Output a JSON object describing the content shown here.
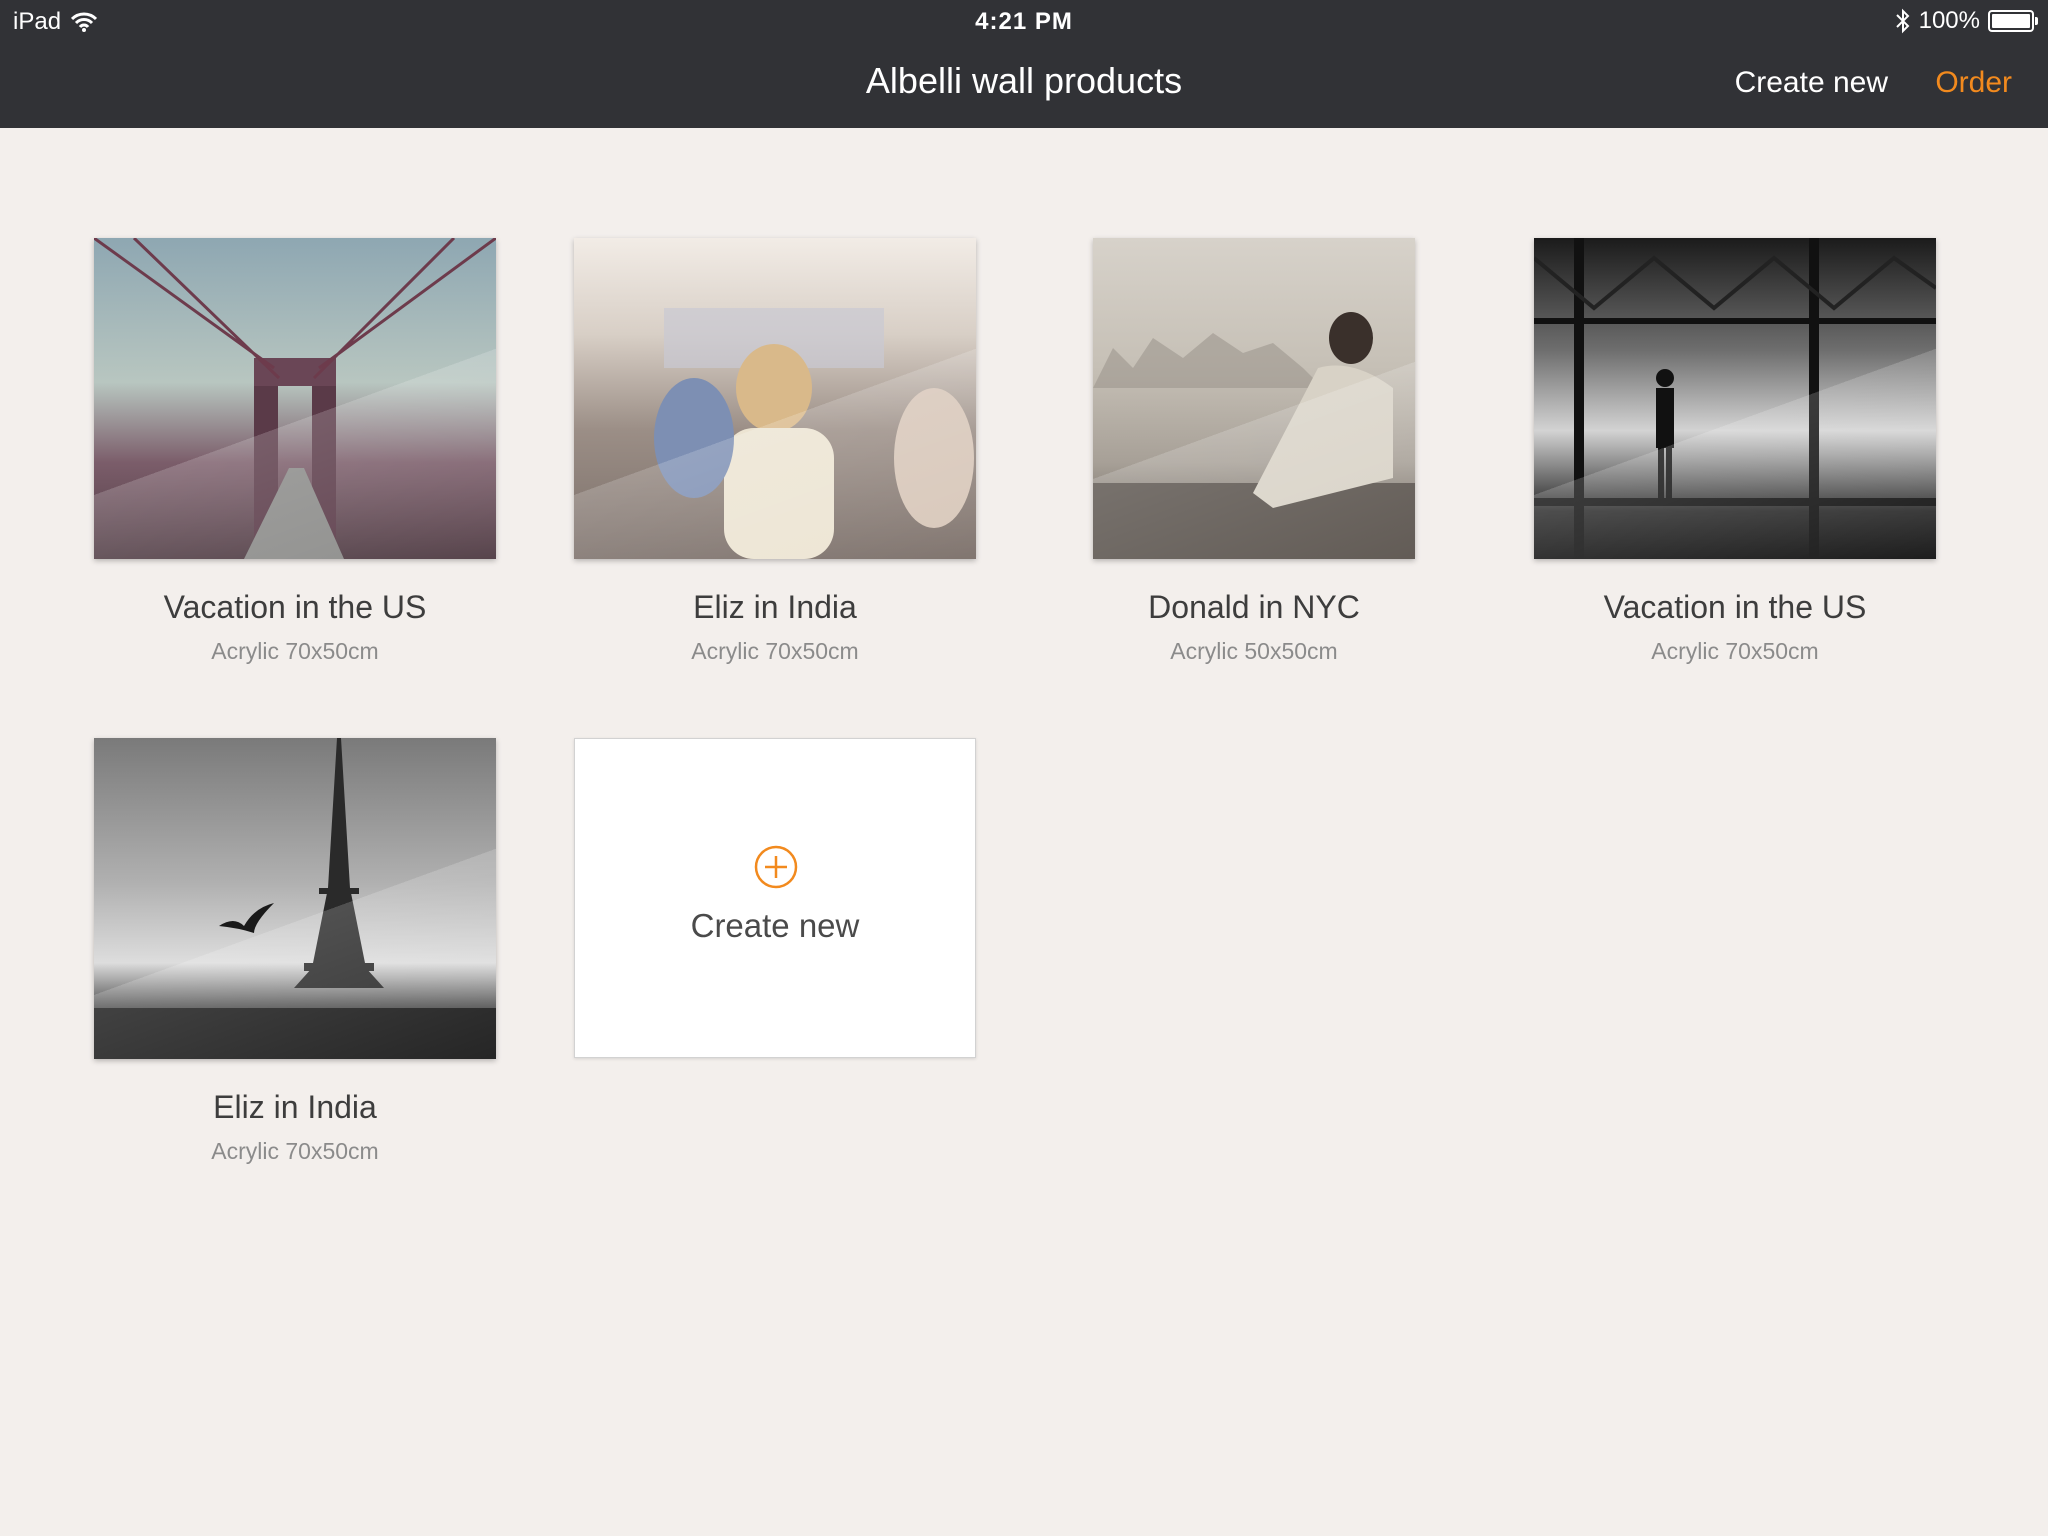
{
  "status_bar": {
    "carrier": "iPad",
    "time": "4:21 PM",
    "battery": "100%",
    "battery_level": 1.0,
    "icons": [
      "wifi-icon",
      "bluetooth-icon",
      "battery-icon"
    ]
  },
  "nav": {
    "title": "Albelli wall products",
    "create_new_label": "Create new",
    "order_label": "Order",
    "accent_color": "#f28a1e"
  },
  "products": [
    {
      "title": "Vacation in the US",
      "subtitle": "Acrylic 70x50cm",
      "image": "brooklyn-bridge-photo"
    },
    {
      "title": "Eliz in India",
      "subtitle": "Acrylic 70x50cm",
      "image": "street-scooters-photo"
    },
    {
      "title": "Donald in NYC",
      "subtitle": "Acrylic 50x50cm",
      "image": "man-by-river-photo"
    },
    {
      "title": "Vacation in the US",
      "subtitle": "Acrylic 70x50cm",
      "image": "hangar-silhouette-photo"
    },
    {
      "title": "Eliz in India",
      "subtitle": "Acrylic 70x50cm",
      "image": "eiffel-tower-photo"
    }
  ],
  "create_card": {
    "label": "Create new",
    "icon": "plus-circle-icon"
  }
}
